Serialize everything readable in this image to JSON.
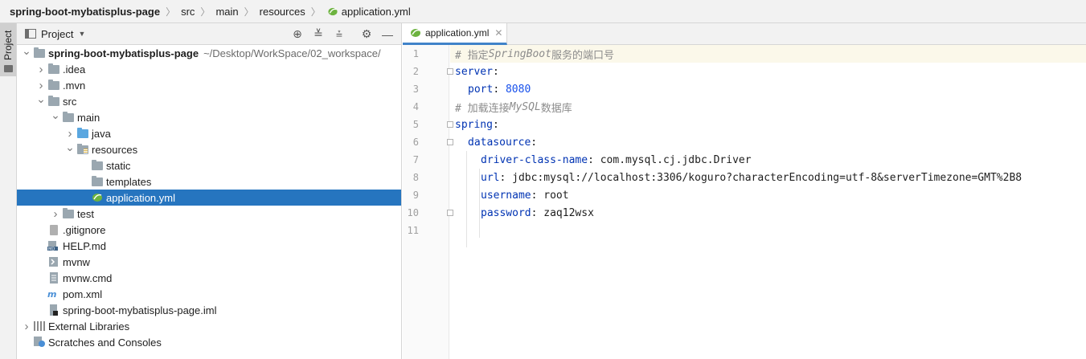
{
  "breadcrumb": {
    "project": "spring-boot-mybatisplus-page",
    "items": [
      "src",
      "main",
      "resources",
      "application.yml"
    ]
  },
  "stripe": {
    "tab_label": "Project"
  },
  "project_panel": {
    "title": "Project",
    "tools": [
      "locate-icon",
      "expand-all-icon",
      "collapse-all-icon",
      "gear-icon",
      "minimize-icon"
    ],
    "tree": [
      {
        "label": "spring-boot-mybatisplus-page",
        "path": "~/Desktop/WorkSpace/02_workspace/",
        "depth": 0,
        "arrow": "down",
        "icon": "project-folder-icon",
        "bold": true
      },
      {
        "label": ".idea",
        "depth": 1,
        "arrow": "right",
        "icon": "folder-icon"
      },
      {
        "label": ".mvn",
        "depth": 1,
        "arrow": "right",
        "icon": "folder-icon"
      },
      {
        "label": "src",
        "depth": 1,
        "arrow": "down",
        "icon": "folder-icon"
      },
      {
        "label": "main",
        "depth": 2,
        "arrow": "down",
        "icon": "folder-icon"
      },
      {
        "label": "java",
        "depth": 3,
        "arrow": "right",
        "icon": "source-folder-icon"
      },
      {
        "label": "resources",
        "depth": 3,
        "arrow": "down",
        "icon": "resources-folder-icon"
      },
      {
        "label": "static",
        "depth": 4,
        "arrow": "",
        "icon": "folder-icon"
      },
      {
        "label": "templates",
        "depth": 4,
        "arrow": "",
        "icon": "folder-icon"
      },
      {
        "label": "application.yml",
        "depth": 4,
        "arrow": "",
        "icon": "spring-yml-icon",
        "selected": true
      },
      {
        "label": "test",
        "depth": 2,
        "arrow": "right",
        "icon": "folder-icon"
      },
      {
        "label": ".gitignore",
        "depth": 1,
        "arrow": "",
        "icon": "gitignore-file-icon"
      },
      {
        "label": "HELP.md",
        "depth": 1,
        "arrow": "",
        "icon": "markdown-file-icon"
      },
      {
        "label": "mvnw",
        "depth": 1,
        "arrow": "",
        "icon": "shell-file-icon"
      },
      {
        "label": "mvnw.cmd",
        "depth": 1,
        "arrow": "",
        "icon": "text-file-icon"
      },
      {
        "label": "pom.xml",
        "depth": 1,
        "arrow": "",
        "icon": "maven-file-icon"
      },
      {
        "label": "spring-boot-mybatisplus-page.iml",
        "depth": 1,
        "arrow": "",
        "icon": "iml-file-icon"
      },
      {
        "label": "External Libraries",
        "depth": 0,
        "arrow": "right",
        "icon": "library-icon"
      },
      {
        "label": "Scratches and Consoles",
        "depth": 0,
        "arrow": "",
        "icon": "scratches-icon"
      }
    ]
  },
  "editor": {
    "tab_label": "application.yml",
    "lines": [
      {
        "n": "1",
        "tokens": [
          [
            "comment",
            "# 指定"
          ],
          [
            "italic",
            "SpringBoot"
          ],
          [
            "comment",
            "服务的端口号"
          ]
        ],
        "indent": 0,
        "highlight": true
      },
      {
        "n": "2",
        "tokens": [
          [
            "key",
            "server"
          ],
          [
            "val",
            ":"
          ]
        ],
        "indent": 0,
        "fold": true
      },
      {
        "n": "3",
        "tokens": [
          [
            "key",
            "port"
          ],
          [
            "val",
            ": "
          ],
          [
            "num",
            "8080"
          ]
        ],
        "indent": 1
      },
      {
        "n": "4",
        "tokens": [
          [
            "comment",
            "# 加载连接"
          ],
          [
            "italic",
            "MySQL"
          ],
          [
            "comment",
            "数据库"
          ]
        ],
        "indent": 0
      },
      {
        "n": "5",
        "tokens": [
          [
            "key",
            "spring"
          ],
          [
            "val",
            ":"
          ]
        ],
        "indent": 0,
        "fold": true
      },
      {
        "n": "6",
        "tokens": [
          [
            "key",
            "datasource"
          ],
          [
            "val",
            ":"
          ]
        ],
        "indent": 1,
        "fold": true
      },
      {
        "n": "7",
        "tokens": [
          [
            "key",
            "driver-class-name"
          ],
          [
            "val",
            ": com.mysql.cj.jdbc.Driver"
          ]
        ],
        "indent": 2
      },
      {
        "n": "8",
        "tokens": [
          [
            "key",
            "url"
          ],
          [
            "val",
            ": jdbc:mysql://localhost:3306/koguro?characterEncoding=utf-8&serverTimezone=GMT%2B8"
          ]
        ],
        "indent": 2
      },
      {
        "n": "9",
        "tokens": [
          [
            "key",
            "username"
          ],
          [
            "val",
            ": root"
          ]
        ],
        "indent": 2
      },
      {
        "n": "10",
        "tokens": [
          [
            "key",
            "password"
          ],
          [
            "val",
            ": zaq12wsx"
          ]
        ],
        "indent": 2,
        "fold": true
      },
      {
        "n": "11",
        "tokens": [],
        "indent": 0
      }
    ]
  },
  "colors": {
    "selection": "#2675bf",
    "key": "#0033b3",
    "number": "#1750eb",
    "comment": "#8c8c8c",
    "tab_underline": "#4083c9"
  }
}
